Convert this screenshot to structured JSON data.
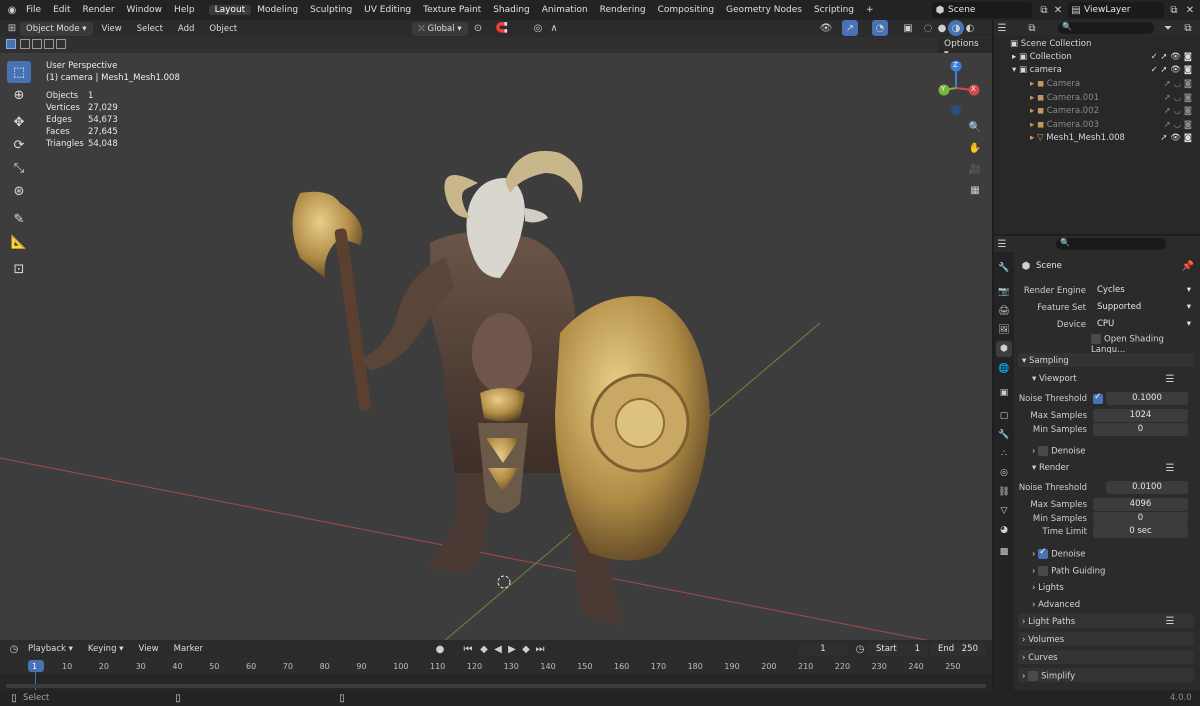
{
  "topbar": {
    "menus": [
      "File",
      "Edit",
      "Render",
      "Window",
      "Help"
    ],
    "workspaces": [
      "Layout",
      "Modeling",
      "Sculpting",
      "UV Editing",
      "Texture Paint",
      "Shading",
      "Animation",
      "Rendering",
      "Compositing",
      "Geometry Nodes",
      "Scripting"
    ],
    "active_workspace": "Layout",
    "add_tab": "+",
    "scene": "Scene",
    "view_layer": "ViewLayer"
  },
  "viewport_header": {
    "mode": "Object Mode",
    "menus": [
      "View",
      "Select",
      "Add",
      "Object"
    ],
    "orientation": "Global",
    "options": "Options"
  },
  "overlay": {
    "perspective": "User Perspective",
    "object_name": "(1) camera | Mesh1_Mesh1.008",
    "stats": [
      {
        "label": "Objects",
        "value": "1"
      },
      {
        "label": "Vertices",
        "value": "27,029"
      },
      {
        "label": "Edges",
        "value": "54,673"
      },
      {
        "label": "Faces",
        "value": "27,645"
      },
      {
        "label": "Triangles",
        "value": "54,048"
      }
    ]
  },
  "gizmo": {
    "z": "Z",
    "y": "Y",
    "x": "X"
  },
  "outliner": {
    "root": "Scene Collection",
    "rows": [
      {
        "name": "Collection",
        "indent": 1
      },
      {
        "name": "camera",
        "indent": 1
      },
      {
        "name": "Camera",
        "indent": 2
      },
      {
        "name": "Camera.001",
        "indent": 2
      },
      {
        "name": "Camera.002",
        "indent": 2
      },
      {
        "name": "Camera.003",
        "indent": 2
      },
      {
        "name": "Mesh1_Mesh1.008",
        "indent": 2
      }
    ]
  },
  "properties": {
    "context": "Scene",
    "render_engine_label": "Render Engine",
    "render_engine": "Cycles",
    "feature_set_label": "Feature Set",
    "feature_set": "Supported",
    "device_label": "Device",
    "device": "CPU",
    "osl": "Open Shading Langu...",
    "sampling": "Sampling",
    "viewport": "Viewport",
    "noise_threshold_label": "Noise Threshold",
    "vp_noise_threshold": "0.1000",
    "max_samples_label": "Max Samples",
    "vp_max_samples": "1024",
    "min_samples_label": "Min Samples",
    "vp_min_samples": "0",
    "denoise": "Denoise",
    "render": "Render",
    "r_noise_threshold": "0.0100",
    "r_max_samples": "4096",
    "r_min_samples": "0",
    "time_limit_label": "Time Limit",
    "time_limit": "0 sec",
    "path_guiding": "Path Guiding",
    "lights": "Lights",
    "advanced": "Advanced",
    "light_paths": "Light Paths",
    "volumes": "Volumes",
    "curves": "Curves",
    "simplify": "Simplify"
  },
  "timeline": {
    "menus": [
      "Playback",
      "Keying",
      "View",
      "Marker"
    ],
    "current_frame": "1",
    "start_label": "Start",
    "start": "1",
    "end_label": "End",
    "end": "250",
    "ticks": [
      "1",
      "10",
      "20",
      "30",
      "40",
      "50",
      "60",
      "70",
      "80",
      "90",
      "100",
      "110",
      "120",
      "130",
      "140",
      "150",
      "160",
      "170",
      "180",
      "190",
      "200",
      "210",
      "220",
      "230",
      "240",
      "250"
    ]
  },
  "statusbar": {
    "select": "Select",
    "version": "4.0.0"
  },
  "colors": {
    "accent": "#4772b3",
    "viewport_bg": "#3d3d3d",
    "x_axis": "#d44a4a",
    "y_axis": "#7ab43a",
    "z_axis": "#3d7fd9"
  }
}
